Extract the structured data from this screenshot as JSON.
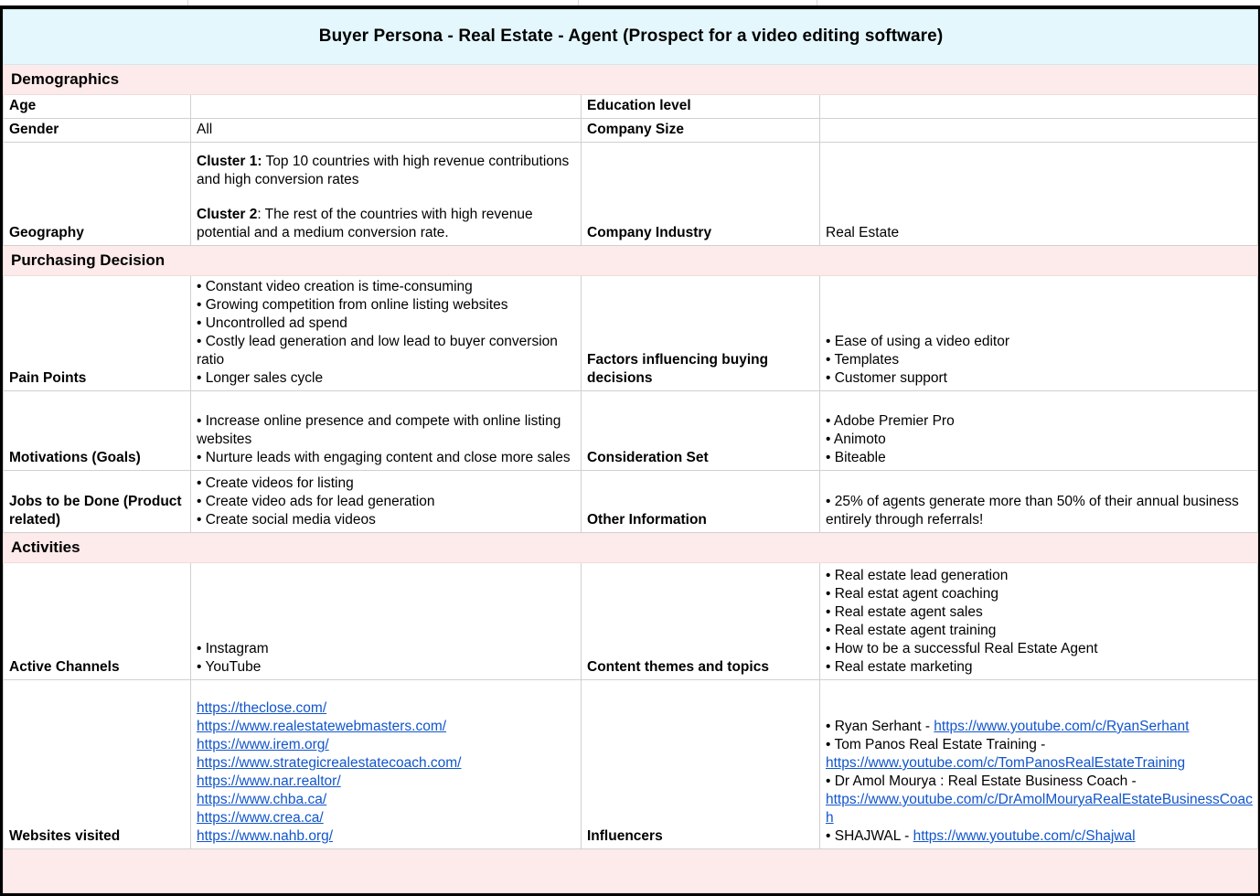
{
  "title": "Buyer Persona - Real Estate - Agent (Prospect for a video editing software)",
  "sections": {
    "demographics": "Demographics",
    "purchasing_decision": "Purchasing Decision",
    "activities": "Activities",
    "footer_blank": ""
  },
  "labels": {
    "age": "Age",
    "education_level": "Education level",
    "gender": "Gender",
    "company_size": "Company Size",
    "geography": "Geography",
    "company_industry": "Company Industry",
    "pain_points": "Pain Points",
    "factors_influencing": "Factors influencing buying decisions",
    "motivations": "Motivations (Goals)",
    "consideration_set": "Consideration Set",
    "jobs_to_be_done": "Jobs to be Done (Product related)",
    "other_information": "Other Information",
    "active_channels": "Active Channels",
    "content_themes": "Content themes and topics",
    "websites_visited": "Websites visited",
    "influencers": "Influencers"
  },
  "values": {
    "age": "",
    "education_level": "",
    "gender": "All",
    "company_size": "",
    "geography_cluster1_label": "Cluster 1:",
    "geography_cluster1_text": " Top 10 countries with high revenue contributions and high conversion rates",
    "geography_cluster2_label": "Cluster 2",
    "geography_cluster2_text": ": The rest of the countries with high revenue potential and a medium conversion rate.",
    "company_industry": "Real Estate",
    "pain_points": "• Constant video creation is time-consuming\n• Growing competition from online listing websites\n• Uncontrolled ad spend\n• Costly lead generation and low lead to buyer conversion ratio\n• Longer sales cycle",
    "factors_influencing": "• Ease of using a video editor\n• Templates\n• Customer support",
    "motivations": "• Increase online presence and compete with online listing websites\n• Nurture leads with engaging content and close more sales",
    "consideration_set": "• Adobe Premier Pro\n• Animoto\n• Biteable",
    "jobs_to_be_done": "• Create videos for listing\n• Create video ads for lead generation\n• Create social media videos",
    "other_information": "• 25% of agents generate more than 50% of their annual business entirely through referrals!",
    "active_channels": "• Instagram\n• YouTube",
    "content_themes": "• Real estate lead generation\n• Real estat agent coaching\n• Real estate agent sales\n• Real estate agent training\n• How to be a successful Real Estate Agent\n• Real estate marketing"
  },
  "websites_visited": [
    "https://theclose.com/",
    "https://www.realestatewebmasters.com/ ",
    "https://www.irem.org/",
    "https://www.strategicrealestatecoach.com/",
    "https://www.nar.realtor/ ",
    "https://www.chba.ca/ ",
    "https://www.crea.ca/ ",
    "https://www.nahb.org/"
  ],
  "influencers": [
    {
      "bullet": "• ",
      "name": "Ryan Serhant - ",
      "url": "https://www.youtube.com/c/RyanSerhant"
    },
    {
      "bullet": "• ",
      "name": "Tom Panos Real Estate Training - ",
      "url": "https://www.youtube.com/c/TomPanosRealEstateTraining"
    },
    {
      "bullet": "• ",
      "name": "Dr Amol Mourya : Real Estate Business Coach - ",
      "url": "https://www.youtube.com/c/DrAmolMouryaRealEstateBusinessCoach"
    },
    {
      "bullet": "• ",
      "name": "SHAJWAL - ",
      "url": "https://www.youtube.com/c/Shajwal"
    }
  ],
  "colors": {
    "title_bg": "#e3f7fd",
    "section_bg": "#fdeaea",
    "link": "#1155cc",
    "grid": "#d0d0d0",
    "outer_border": "#000000"
  }
}
